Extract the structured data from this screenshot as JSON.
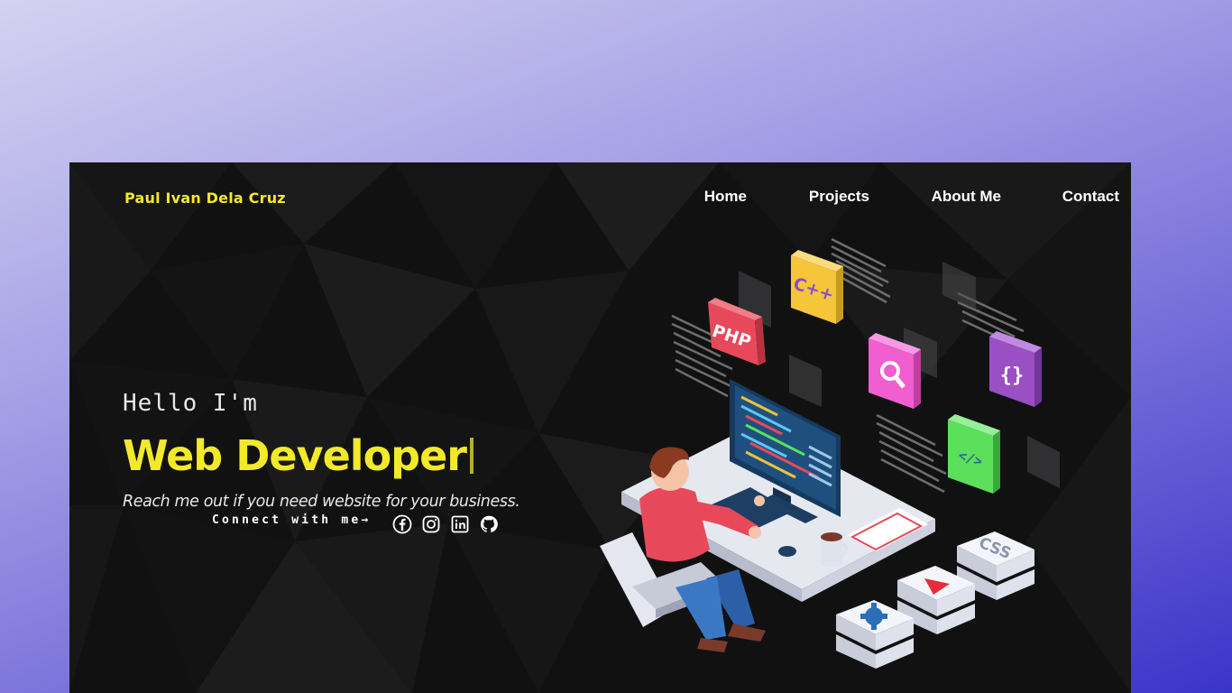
{
  "header": {
    "logo": "Paul Ivan Dela Cruz",
    "nav": [
      {
        "label": "Home"
      },
      {
        "label": "Projects"
      },
      {
        "label": "About Me"
      },
      {
        "label": "Contact"
      }
    ]
  },
  "hero": {
    "greeting": "Hello I'm",
    "role": "Web Developer",
    "tagline": "Reach me out if you need website for your business.",
    "connect_label": "Connect with me→"
  },
  "socials": [
    {
      "icon": "facebook-icon"
    },
    {
      "icon": "instagram-icon"
    },
    {
      "icon": "linkedin-icon"
    },
    {
      "icon": "github-icon"
    }
  ],
  "illustration": {
    "tiles": [
      "PHP",
      "C++",
      "{}",
      "</>",
      "CSS"
    ]
  },
  "colors": {
    "accent": "#f2e92a",
    "page_background": "#0f0f10",
    "outer_gradient_start": "#d4d2f1",
    "outer_gradient_end": "#3b34c9"
  }
}
